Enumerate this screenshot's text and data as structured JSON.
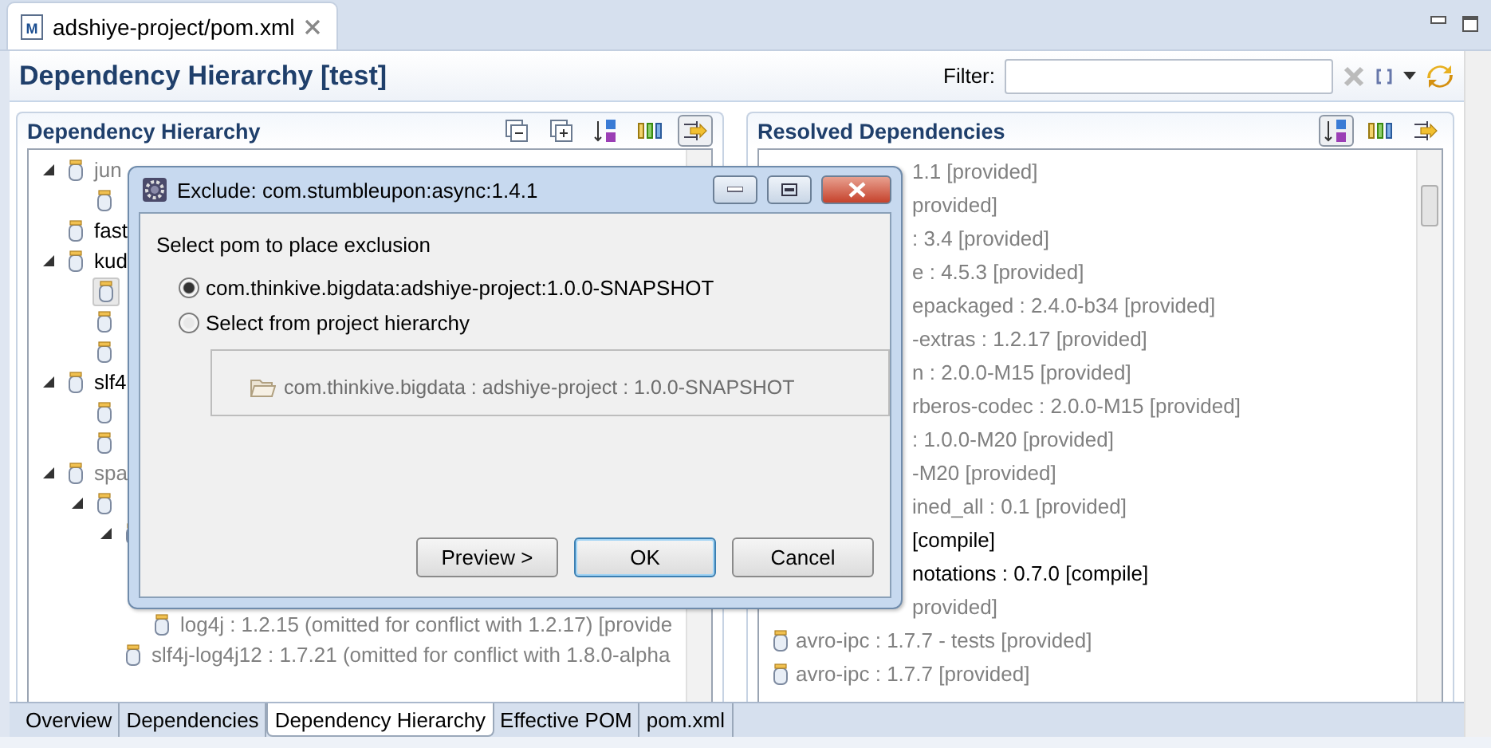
{
  "editor_tab": {
    "title": "adshiye-project/pom.xml",
    "icon_letter": "M"
  },
  "header": {
    "title": "Dependency Hierarchy [test]",
    "filter_label": "Filter:"
  },
  "hierarchy": {
    "title": "Dependency Hierarchy",
    "nodes": [
      {
        "label": "jun",
        "greyed": true,
        "expanded": true,
        "selected": false,
        "children": [
          {
            "selected": false
          }
        ]
      },
      {
        "label": "fast",
        "greyed": false,
        "selected": false
      },
      {
        "label": "kud",
        "greyed": false,
        "expanded": true,
        "selected": false,
        "children": [
          {
            "selected": true
          },
          {
            "selected": false
          },
          {
            "selected": false
          }
        ]
      },
      {
        "label": "slf4",
        "greyed": false,
        "expanded": true,
        "selected": false,
        "children": [
          {
            "selected": false
          },
          {
            "selected": false
          }
        ]
      },
      {
        "label": "spa",
        "greyed": true,
        "expanded": true,
        "selected": false,
        "children": [
          {
            "expanded": true,
            "selected": false,
            "children": [
              {
                "expanded": true,
                "selected": false,
                "children": [
                  {
                    "label": "log4j : 1.2.15 (omitted for conflict with 1.2.17) [provide",
                    "greyed": true,
                    "selected": false
                  }
                ]
              },
              {
                "label": "slf4j-log4j12 : 1.7.21 (omitted for conflict with 1.8.0-alpha",
                "greyed": true,
                "selected": false
              }
            ]
          }
        ]
      }
    ]
  },
  "resolved": {
    "title": "Resolved Dependencies",
    "rows": [
      {
        "kind": "clipped",
        "text": "1.1 [provided]",
        "greyed": true
      },
      {
        "kind": "clipped",
        "text": "provided]",
        "greyed": true
      },
      {
        "kind": "clipped",
        "text": ": 3.4 [provided]",
        "greyed": true
      },
      {
        "kind": "clipped",
        "text": "e : 4.5.3 [provided]",
        "greyed": true
      },
      {
        "kind": "clipped",
        "text": "epackaged : 2.4.0-b34 [provided]",
        "greyed": true
      },
      {
        "kind": "clipped",
        "text": "-extras : 1.2.17 [provided]",
        "greyed": true
      },
      {
        "kind": "clipped",
        "text": "n : 2.0.0-M15 [provided]",
        "greyed": true
      },
      {
        "kind": "clipped",
        "text": "rberos-codec : 2.0.0-M15 [provided]",
        "greyed": true
      },
      {
        "kind": "clipped",
        "text": ": 1.0.0-M20 [provided]",
        "greyed": true
      },
      {
        "kind": "clipped",
        "text": "-M20 [provided]",
        "greyed": true
      },
      {
        "kind": "clipped",
        "text": "ined_all : 0.1 [provided]",
        "greyed": true
      },
      {
        "kind": "clipped",
        "text": "[compile]",
        "greyed": false
      },
      {
        "kind": "clipped",
        "text": "notations : 0.7.0 [compile]",
        "greyed": false
      },
      {
        "kind": "clipped",
        "text": "provided]",
        "greyed": true
      },
      {
        "kind": "full",
        "text": "avro-ipc : 1.7.7 - tests [provided]",
        "greyed": true
      },
      {
        "kind": "full",
        "text": "avro-ipc : 1.7.7 [provided]",
        "greyed": true
      }
    ]
  },
  "page_tabs": [
    {
      "label": "Overview",
      "selected": false
    },
    {
      "label": "Dependencies",
      "selected": false
    },
    {
      "label": "Dependency Hierarchy",
      "selected": true
    },
    {
      "label": "Effective POM",
      "selected": false
    },
    {
      "label": "pom.xml",
      "selected": false
    }
  ],
  "dialog": {
    "title": "Exclude: com.stumbleupon:async:1.4.1",
    "prompt": "Select pom to place exclusion",
    "options": [
      {
        "label": "com.thinkive.bigdata:adshiye-project:1.0.0-SNAPSHOT",
        "selected": true
      },
      {
        "label": "Select from project hierarchy",
        "selected": false
      }
    ],
    "hierarchy_item": {
      "label": "com.thinkive.bigdata : adshiye-project : 1.0.0-SNAPSHOT",
      "disabled": true
    },
    "buttons": [
      {
        "label": "Preview >",
        "default": false
      },
      {
        "label": "OK",
        "default": true
      },
      {
        "label": "Cancel",
        "default": false
      }
    ]
  }
}
